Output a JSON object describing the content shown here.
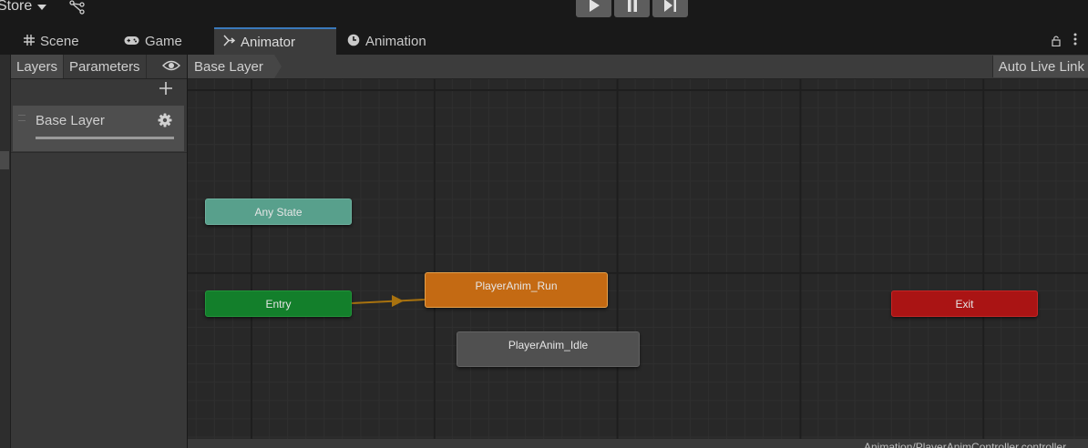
{
  "toolbar": {
    "store_label": "Store",
    "play_icon": "play-icon",
    "pause_icon": "pause-icon",
    "step_icon": "step-icon",
    "graph_icon": "graph-icon"
  },
  "tabs": [
    {
      "label": "Scene",
      "icon": "grid-icon"
    },
    {
      "label": "Game",
      "icon": "gamepad-icon"
    },
    {
      "label": "Animator",
      "icon": "animator-icon",
      "active": true
    },
    {
      "label": "Animation",
      "icon": "clock-icon"
    }
  ],
  "layers_panel": {
    "tab_layers": "Layers",
    "tab_parameters": "Parameters",
    "layer_name": "Base Layer"
  },
  "canvas": {
    "breadcrumb": "Base Layer",
    "auto_live_link": "Auto Live Link",
    "status_path": "Animation/PlayerAnimController.controller"
  },
  "states": {
    "any_state": "Any State",
    "entry": "Entry",
    "run": "PlayerAnim_Run",
    "idle": "PlayerAnim_Idle",
    "exit": "Exit"
  },
  "colors": {
    "accent": "#3a79bb",
    "any_state": "#58a08c",
    "entry": "#137f2b",
    "default_state": "#c46a13",
    "state": "#505050",
    "exit": "#aa1414",
    "transition": "#a8720f"
  }
}
